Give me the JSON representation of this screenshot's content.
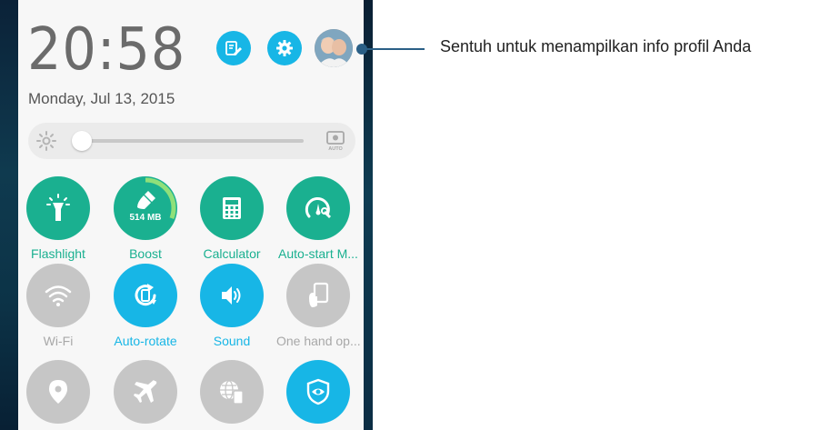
{
  "status": {
    "time": "20:58",
    "date": "Monday, Jul 13, 2015"
  },
  "top_actions": [
    {
      "icon": "edit-icon",
      "color": "#17b6e6"
    },
    {
      "icon": "gear-icon",
      "color": "#17b6e6"
    },
    {
      "icon": "profile-avatar"
    }
  ],
  "brightness": {
    "level": 0.04,
    "auto_label": "AUTO"
  },
  "quick_settings": [
    {
      "label": "Flashlight",
      "icon": "flashlight-icon",
      "state": "on",
      "color": "#1ab090"
    },
    {
      "label": "Boost",
      "icon": "broom-icon",
      "state": "on",
      "color": "#1ab090",
      "value": "514 MB"
    },
    {
      "label": "Calculator",
      "icon": "calculator-icon",
      "state": "on",
      "color": "#1ab090"
    },
    {
      "label": "Auto-start M...",
      "icon": "speedometer-wrench-icon",
      "state": "on",
      "color": "#1ab090"
    },
    {
      "label": "Wi-Fi",
      "icon": "wifi-icon",
      "state": "off",
      "color": "#c6c6c6"
    },
    {
      "label": "Auto-rotate",
      "icon": "rotate-icon",
      "state": "on",
      "color": "#17b6e6"
    },
    {
      "label": "Sound",
      "icon": "speaker-icon",
      "state": "on",
      "color": "#17b6e6"
    },
    {
      "label": "One hand op...",
      "icon": "one-hand-icon",
      "state": "off",
      "color": "#c6c6c6"
    },
    {
      "label": "",
      "icon": "location-icon",
      "state": "off",
      "color": "#c6c6c6"
    },
    {
      "label": "",
      "icon": "airplane-icon",
      "state": "off",
      "color": "#c6c6c6"
    },
    {
      "label": "",
      "icon": "globe-device-icon",
      "state": "off",
      "color": "#c6c6c6"
    },
    {
      "label": "",
      "icon": "eye-shield-icon",
      "state": "on",
      "color": "#17b6e6"
    }
  ],
  "callout": {
    "text": "Sentuh untuk menampilkan info profil Anda",
    "color": "#2a5f86"
  }
}
